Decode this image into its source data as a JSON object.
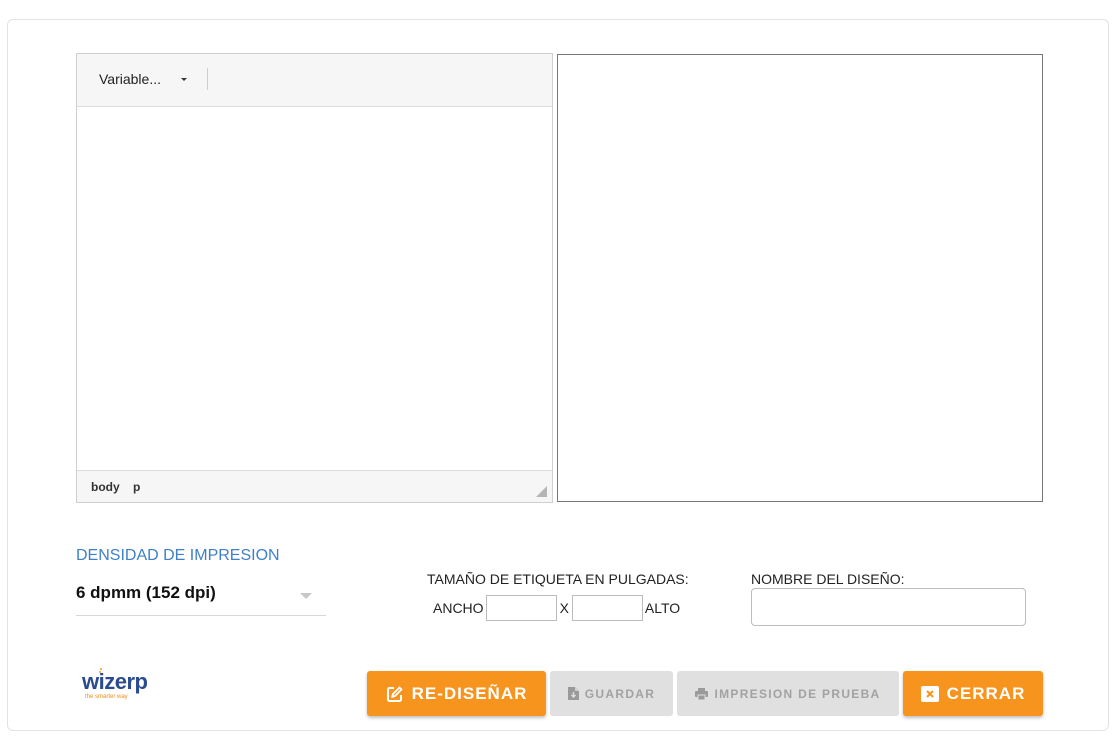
{
  "editor": {
    "toolbar": {
      "variables_label": "Variable..."
    },
    "statusbar": {
      "path": [
        "body",
        "p"
      ]
    }
  },
  "density": {
    "label": "DENSIDAD DE IMPRESION",
    "selected": "6 dpmm (152 dpi)"
  },
  "label_size": {
    "label": "TAMAÑO DE ETIQUETA EN PULGADAS:",
    "width_label": "ANCHO",
    "separator": "X",
    "height_label": "ALTO",
    "width_value": "",
    "height_value": ""
  },
  "design_name": {
    "label": "NOMBRE DEL DISEÑO:",
    "value": ""
  },
  "logo": {
    "word": "wizerp",
    "tagline": "the smarter way"
  },
  "buttons": {
    "redesign": "RE-DISEÑAR",
    "save": "GUARDAR",
    "test_print": "IMPRESION DE PRUEBA",
    "close": "CERRAR"
  },
  "icons": {
    "redesign": "edit-icon",
    "save": "file-save-icon",
    "test_print": "printer-icon",
    "close": "close-box-icon"
  },
  "colors": {
    "accent": "#f7941d",
    "label_blue": "#3f7fc9",
    "disabled_bg": "#e0e0e0",
    "logo_blue": "#2b4a8f"
  }
}
